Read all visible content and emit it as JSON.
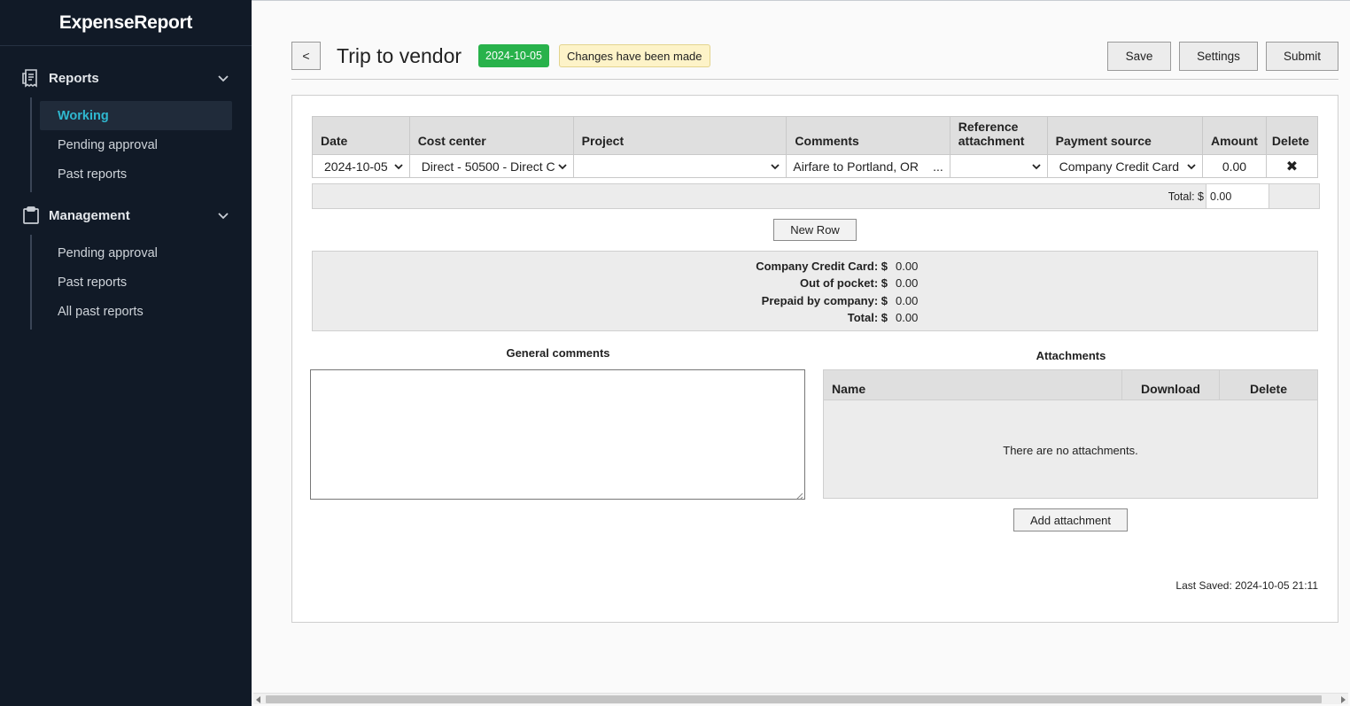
{
  "app": {
    "brand": "ExpenseReport"
  },
  "sidebar": {
    "sections": [
      {
        "label": "Reports",
        "icon": "receipt-icon",
        "items": [
          {
            "label": "Working",
            "active": true
          },
          {
            "label": "Pending approval"
          },
          {
            "label": "Past reports"
          }
        ]
      },
      {
        "label": "Management",
        "icon": "clipboard-icon",
        "items": [
          {
            "label": "Pending approval"
          },
          {
            "label": "Past reports"
          },
          {
            "label": "All past reports"
          }
        ]
      }
    ]
  },
  "header": {
    "back_label": "<",
    "title": "Trip to vendor",
    "date_badge": "2024-10-05",
    "status_badge": "Changes have been made",
    "save_label": "Save",
    "settings_label": "Settings",
    "submit_label": "Submit"
  },
  "table": {
    "columns": [
      "Date",
      "Cost center",
      "Project",
      "Comments",
      "Reference attachment",
      "Payment source",
      "Amount",
      "Delete"
    ],
    "rows": [
      {
        "date": "2024-10-05",
        "cost_center": "Direct - 50500 - Direct C",
        "project": "",
        "comments": "Airfare to Portland, OR",
        "comments_more": "...",
        "reference": "",
        "payment_source": "Company Credit Card",
        "amount": "0.00",
        "delete": "✖"
      }
    ],
    "total_label": "Total: $",
    "total_value": "0.00",
    "new_row_label": "New Row"
  },
  "summary": {
    "lines": [
      {
        "label": "Company Credit Card: $",
        "value": "0.00"
      },
      {
        "label": "Out of pocket: $",
        "value": "0.00"
      },
      {
        "label": "Prepaid by company: $",
        "value": "0.00"
      },
      {
        "label": "Total: $",
        "value": "0.00"
      }
    ]
  },
  "general_comments": {
    "title": "General comments",
    "value": ""
  },
  "attachments": {
    "title": "Attachments",
    "columns": [
      "Name",
      "Download",
      "Delete"
    ],
    "empty_text": "There are no attachments.",
    "add_label": "Add attachment"
  },
  "footer": {
    "last_saved": "Last Saved: 2024-10-05 21:11"
  },
  "colors": {
    "sidebar_bg": "#111a27",
    "active": "#2fb8d0",
    "date_badge": "#28b24b",
    "status_badge": "#fdf3c8"
  }
}
